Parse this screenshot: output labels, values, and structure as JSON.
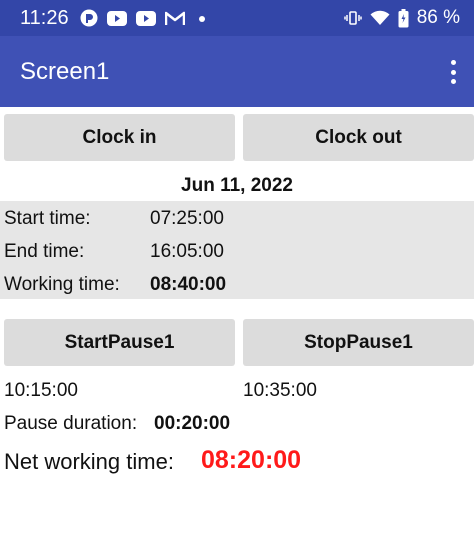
{
  "status_bar": {
    "time": "11:26",
    "battery_percent": "86 %",
    "left_icons": [
      "app-c-icon",
      "youtube-icon",
      "youtube-icon",
      "gmail-icon",
      "dot-icon"
    ],
    "right_icons": [
      "vibrate-icon",
      "wifi-icon",
      "battery-icon"
    ]
  },
  "app_bar": {
    "title": "Screen1",
    "menu_icon": "more-vert-icon"
  },
  "buttons": {
    "clock_in": "Clock in",
    "clock_out": "Clock out",
    "start_pause": "StartPause1",
    "stop_pause": "StopPause1"
  },
  "date": "Jun 11, 2022",
  "times": {
    "start_label": "Start time:",
    "start_value": "07:25:00",
    "end_label": "End time:",
    "end_value": "16:05:00",
    "working_label": "Working time:",
    "working_value": "08:40:00"
  },
  "pause": {
    "start_time": "10:15:00",
    "stop_time": "10:35:00",
    "duration_label": "Pause duration:",
    "duration_value": "00:20:00"
  },
  "net": {
    "label": "Net working time:",
    "value": "08:20:00",
    "color": "#ff1a1a"
  },
  "colors": {
    "status_bar": "#3346a8",
    "app_bar": "#3f51b5",
    "button": "#dcdcdc",
    "panel": "#e6e6e6"
  }
}
